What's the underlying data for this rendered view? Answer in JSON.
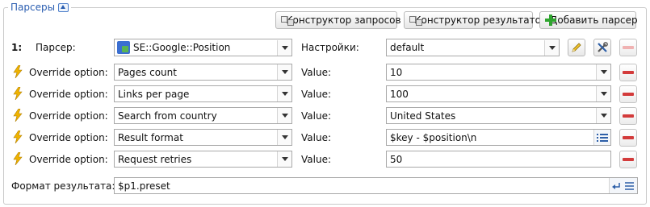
{
  "group": {
    "title": "Парсеры"
  },
  "toolbar": {
    "query_builder_label": "Конструктор запросов",
    "result_builder_label": "Конструктор результатов",
    "add_parser_label": "Добавить парсер"
  },
  "parser": {
    "index": "1:",
    "label": "Парсер:",
    "value": "SE::Google::Position",
    "settings_label": "Настройки:",
    "settings_value": "default"
  },
  "overrides": [
    {
      "label": "Override option:",
      "option": "Pages count",
      "value_label": "Value:",
      "value": "10"
    },
    {
      "label": "Override option:",
      "option": "Links per page",
      "value_label": "Value:",
      "value": "100"
    },
    {
      "label": "Override option:",
      "option": "Search from country",
      "value_label": "Value:",
      "value": "United States"
    },
    {
      "label": "Override option:",
      "option": "Result format",
      "value_label": "Value:",
      "value": "$key - $position\\n"
    },
    {
      "label": "Override option:",
      "option": "Request retries",
      "value_label": "Value:",
      "value": "50"
    }
  ],
  "result_format": {
    "label": "Формат результата:",
    "value": "$p1.preset"
  },
  "colors": {
    "accent": "#2a5db0",
    "remove": "#d33b3b",
    "bolt": "#f0b400",
    "add": "#2fa52f"
  },
  "icons": [
    "collapse-icon",
    "constructor-icon",
    "plus-icon",
    "google-icon",
    "pencil-icon",
    "tools-icon",
    "bolt-icon",
    "list-icon",
    "wrap-icon"
  ]
}
